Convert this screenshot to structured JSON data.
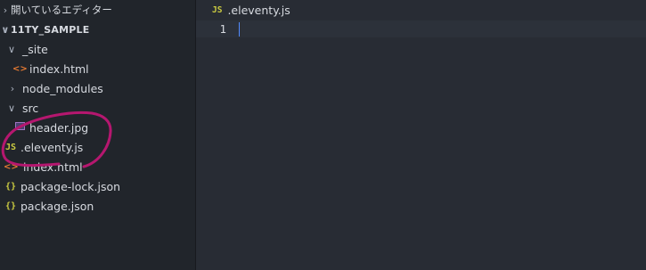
{
  "sidebar": {
    "open_editors_label": "開いているエディター",
    "project_label": "11TY_SAMPLE",
    "items": [
      {
        "label": "_site",
        "type": "folder",
        "expanded": true,
        "depth": 0
      },
      {
        "label": "index.html",
        "type": "html",
        "depth": 1
      },
      {
        "label": "node_modules",
        "type": "folder",
        "expanded": false,
        "depth": 0
      },
      {
        "label": "src",
        "type": "folder",
        "expanded": true,
        "depth": 0
      },
      {
        "label": "header.jpg",
        "type": "image",
        "depth": 1
      },
      {
        "label": ".eleventy.js",
        "type": "js",
        "depth": 0
      },
      {
        "label": "index.html",
        "type": "html",
        "depth": 1
      },
      {
        "label": "package-lock.json",
        "type": "json",
        "depth": 0
      },
      {
        "label": "package.json",
        "type": "json",
        "depth": 0
      }
    ],
    "icons": {
      "html": "<>",
      "js": "JS",
      "json": "{}",
      "chevron_down": "∨",
      "chevron_right": "›"
    }
  },
  "editor": {
    "tab_label": ".eleventy.js",
    "tab_icon": "JS",
    "line_number": "1"
  },
  "colors": {
    "annotation": "#b5176f",
    "sidebar_bg": "#21252b",
    "editor_bg": "#282c34"
  }
}
